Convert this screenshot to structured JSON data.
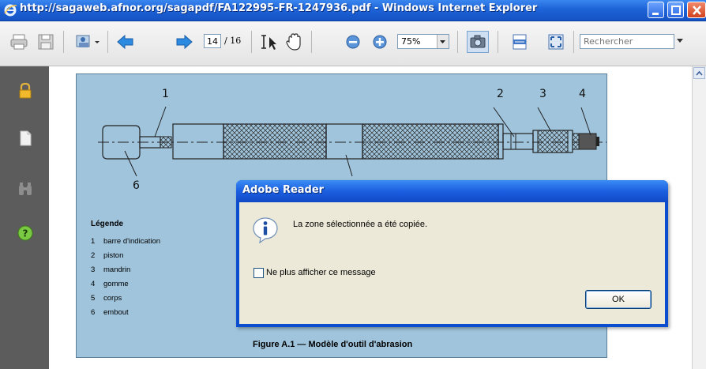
{
  "window": {
    "title": "http://sagaweb.afnor.org/sagapdf/FA122995-FR-1247936.pdf - Windows Internet Explorer"
  },
  "toolbar": {
    "page_current": "14",
    "page_total": "/ 16",
    "zoom": "75%",
    "search_placeholder": "Rechercher"
  },
  "document": {
    "callouts": [
      "1",
      "2",
      "3",
      "4",
      "6"
    ],
    "legend_title": "Légende",
    "legend": [
      {
        "num": "1",
        "label": "barre d'indication"
      },
      {
        "num": "2",
        "label": "piston"
      },
      {
        "num": "3",
        "label": "mandrin"
      },
      {
        "num": "4",
        "label": "gomme"
      },
      {
        "num": "5",
        "label": "corps"
      },
      {
        "num": "6",
        "label": "embout"
      }
    ],
    "figure_caption": "Figure A.1 — Modèle d'outil d'abrasion"
  },
  "dialog": {
    "title": "Adobe Reader",
    "message": "La zone sélectionnée a été copiée.",
    "checkbox_label": "Ne plus afficher ce message",
    "checkbox_checked": false,
    "ok_label": "OK"
  },
  "colors": {
    "titlebar": "#1d63d8",
    "leftnav": "#5c5c5c",
    "page_background": "#9fc4dc",
    "dialog_body": "#ece9d8"
  }
}
